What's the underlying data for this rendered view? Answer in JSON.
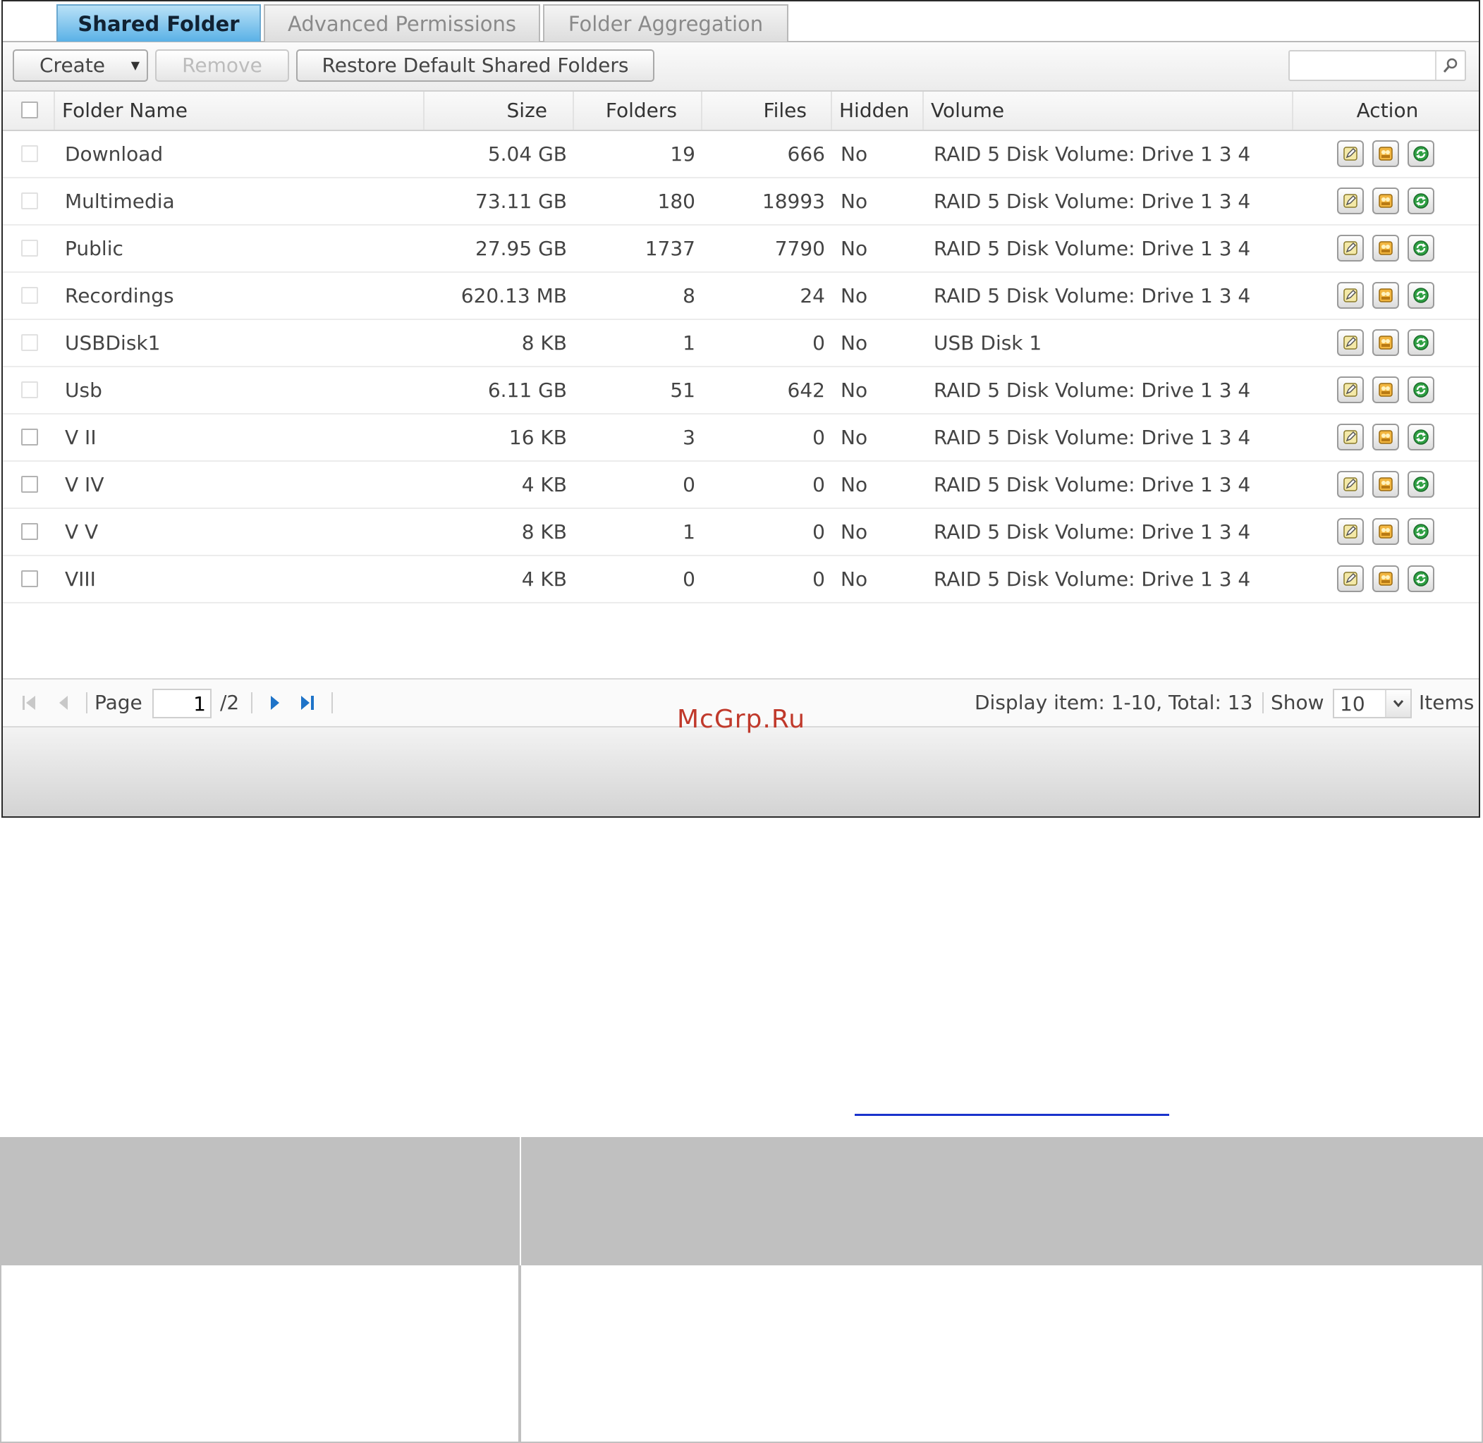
{
  "tabs": [
    {
      "label": "Shared Folder",
      "active": true
    },
    {
      "label": "Advanced Permissions",
      "active": false
    },
    {
      "label": "Folder Aggregation",
      "active": false
    }
  ],
  "toolbar": {
    "create_label": "Create",
    "remove_label": "Remove",
    "restore_label": "Restore Default Shared Folders",
    "search_placeholder": ""
  },
  "columns": {
    "name": "Folder Name",
    "size": "Size",
    "folders": "Folders",
    "files": "Files",
    "hidden": "Hidden",
    "volume": "Volume",
    "action": "Action"
  },
  "rows": [
    {
      "name": "Download",
      "size": "5.04 GB",
      "folders": "19",
      "files": "666",
      "hidden": "No",
      "volume": "RAID 5 Disk Volume: Drive 1 3 4"
    },
    {
      "name": "Multimedia",
      "size": "73.11 GB",
      "folders": "180",
      "files": "18993",
      "hidden": "No",
      "volume": "RAID 5 Disk Volume: Drive 1 3 4"
    },
    {
      "name": "Public",
      "size": "27.95 GB",
      "folders": "1737",
      "files": "7790",
      "hidden": "No",
      "volume": "RAID 5 Disk Volume: Drive 1 3 4"
    },
    {
      "name": "Recordings",
      "size": "620.13 MB",
      "folders": "8",
      "files": "24",
      "hidden": "No",
      "volume": "RAID 5 Disk Volume: Drive 1 3 4"
    },
    {
      "name": "USBDisk1",
      "size": "8 KB",
      "folders": "1",
      "files": "0",
      "hidden": "No",
      "volume": "USB Disk 1"
    },
    {
      "name": "Usb",
      "size": "6.11 GB",
      "folders": "51",
      "files": "642",
      "hidden": "No",
      "volume": "RAID 5 Disk Volume: Drive 1 3 4"
    },
    {
      "name": "V II",
      "size": "16 KB",
      "folders": "3",
      "files": "0",
      "hidden": "No",
      "volume": "RAID 5 Disk Volume: Drive 1 3 4"
    },
    {
      "name": "V IV",
      "size": "4 KB",
      "folders": "0",
      "files": "0",
      "hidden": "No",
      "volume": "RAID 5 Disk Volume: Drive 1 3 4"
    },
    {
      "name": "V V",
      "size": "8 KB",
      "folders": "1",
      "files": "0",
      "hidden": "No",
      "volume": "RAID 5 Disk Volume: Drive 1 3 4"
    },
    {
      "name": "VIII",
      "size": "4 KB",
      "folders": "0",
      "files": "0",
      "hidden": "No",
      "volume": "RAID 5 Disk Volume: Drive 1 3 4"
    }
  ],
  "pager": {
    "page_label": "Page",
    "page_value": "1",
    "page_total": "/2",
    "display_text": "Display item: 1-10, Total: 13",
    "show_label": "Show",
    "show_value": "10",
    "items_label": "Items"
  },
  "watermark": "McGrp.Ru"
}
